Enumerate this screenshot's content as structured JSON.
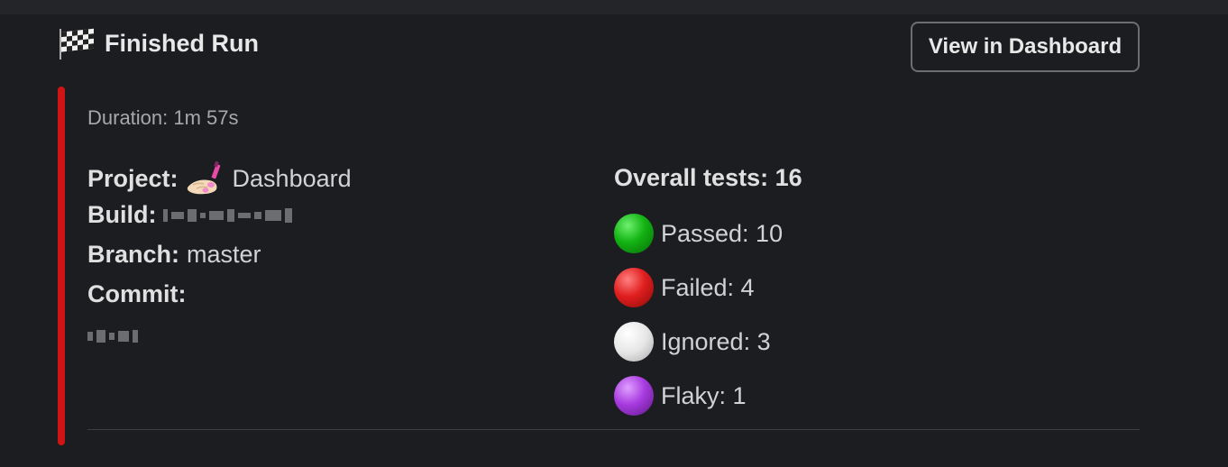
{
  "header": {
    "title": "Finished Run",
    "flag_icon": "checkered-flag-icon",
    "dashboard_button_label": "View in Dashboard"
  },
  "colors": {
    "accent_bar": "#cf1414",
    "passed": "#12b312",
    "failed": "#e01e1e",
    "ignored": "#e6e6e6",
    "flaky": "#a83be0"
  },
  "details": {
    "duration": "Duration: 1m 57s",
    "project_label": "Project",
    "project_value": "Dashboard",
    "project_icon": "nail-polish-icon",
    "build_label": "Build:",
    "branch_label": "Branch:",
    "branch_value": "master",
    "commit_label": "Commit:"
  },
  "tests": {
    "overall": "Overall tests: 16",
    "passed": "Passed: 10",
    "failed": "Failed: 4",
    "ignored": "Ignored: 3",
    "flaky": "Flaky: 1"
  }
}
